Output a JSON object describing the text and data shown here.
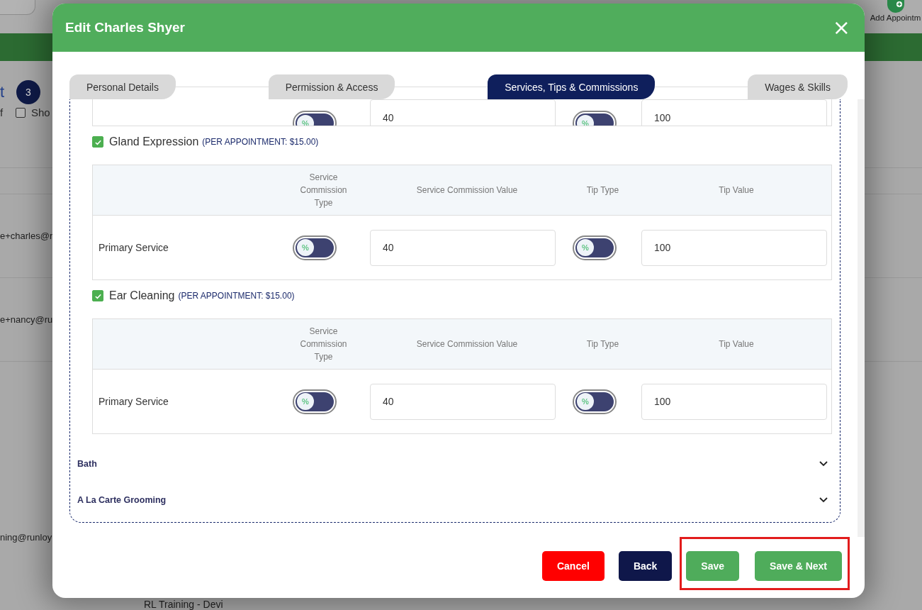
{
  "background": {
    "header_fragment": "t",
    "count_badge": "3",
    "filter_fragment": "f",
    "show_checkbox": {
      "label": "Sho",
      "checked": false
    },
    "emails": [
      "e+charles@r",
      "e+nancy@ru",
      "ning@runloy"
    ],
    "toolbar_label": "Add Appointm",
    "footer_text": "RL Training - Devi"
  },
  "modal": {
    "title": "Edit Charles Shyer",
    "close": "×",
    "tabs": [
      {
        "label": "Personal Details",
        "selected": false
      },
      {
        "label": "Permission & Access",
        "selected": false
      },
      {
        "label": "Services, Tips & Commissions",
        "selected": true
      },
      {
        "label": "Wages & Skills",
        "selected": false
      }
    ],
    "partial_row": {
      "commission_toggle": {
        "on": false,
        "symbol": "%"
      },
      "commission_value": "40",
      "tip_toggle": {
        "on": false,
        "symbol": "%"
      },
      "tip_value": "100"
    },
    "services": [
      {
        "name": "Gland Expression",
        "note": "(PER APPOINTMENT: $15.00)",
        "checked": true,
        "columns": [
          "Service Commission Type",
          "Service Commission Value",
          "Tip Type",
          "Tip Value"
        ],
        "rows": [
          {
            "label": "Primary Service",
            "commission_toggle": {
              "on": false,
              "symbol": "%"
            },
            "commission_value": "40",
            "tip_toggle": {
              "on": false,
              "symbol": "%"
            },
            "tip_value": "100"
          }
        ]
      },
      {
        "name": "Ear Cleaning",
        "note": "(PER APPOINTMENT: $15.00)",
        "checked": true,
        "columns": [
          "Service Commission Type",
          "Service Commission Value",
          "Tip Type",
          "Tip Value"
        ],
        "rows": [
          {
            "label": "Primary Service",
            "commission_toggle": {
              "on": false,
              "symbol": "%"
            },
            "commission_value": "40",
            "tip_toggle": {
              "on": false,
              "symbol": "%"
            },
            "tip_value": "100"
          }
        ]
      }
    ],
    "categories": [
      {
        "name": "Bath",
        "expanded": false
      },
      {
        "name": "A La Carte Grooming",
        "expanded": false
      }
    ],
    "buttons": [
      {
        "label": "Cancel",
        "kind": "danger"
      },
      {
        "label": "Back",
        "kind": "secondary"
      }
    ],
    "highlighted_buttons": [
      {
        "label": "Save",
        "kind": "primary"
      },
      {
        "label": "Save & Next",
        "kind": "primary"
      }
    ]
  }
}
